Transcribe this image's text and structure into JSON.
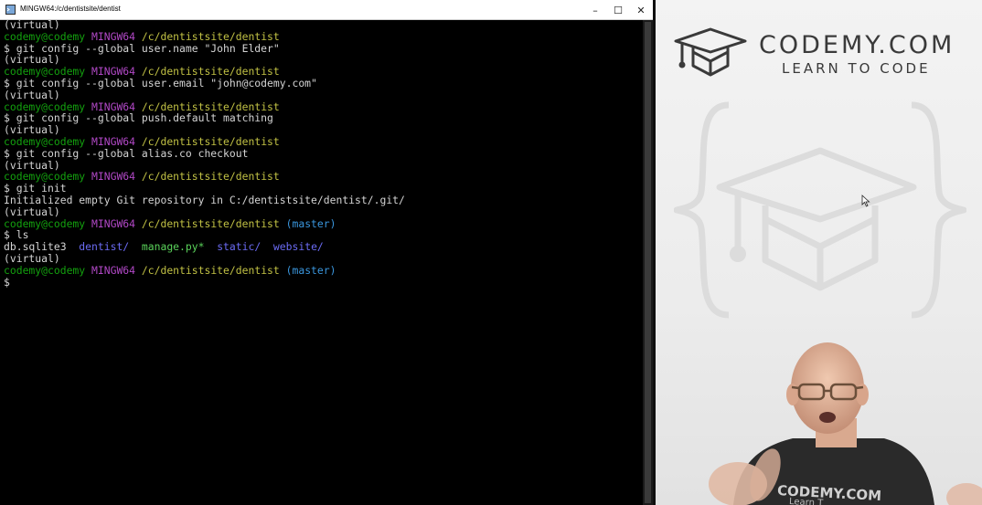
{
  "window": {
    "title": "MINGW64:/c/dentistsite/dentist",
    "minimize_glyph": "–",
    "maximize_glyph": "☐",
    "close_glyph": "✕"
  },
  "colors": {
    "terminal_bg": "#000000",
    "user": "#13a10e",
    "shell": "#b148c6",
    "path": "#c1c144",
    "branch": "#3a96dd",
    "directory": "#6b6bf3",
    "executable": "#5ad25a"
  },
  "terminal": {
    "lines": [
      [
        {
          "t": "(virtual)",
          "c": "white"
        }
      ],
      [
        {
          "t": "codemy@codemy",
          "c": "green"
        },
        {
          "t": " ",
          "c": "white"
        },
        {
          "t": "MINGW64",
          "c": "magenta"
        },
        {
          "t": " ",
          "c": "white"
        },
        {
          "t": "/c/dentistsite/dentist",
          "c": "yellow"
        }
      ],
      [
        {
          "t": "$ git config --global user.name \"John Elder\"",
          "c": "white"
        }
      ],
      [
        {
          "t": "(virtual)",
          "c": "white"
        }
      ],
      [
        {
          "t": "codemy@codemy",
          "c": "green"
        },
        {
          "t": " ",
          "c": "white"
        },
        {
          "t": "MINGW64",
          "c": "magenta"
        },
        {
          "t": " ",
          "c": "white"
        },
        {
          "t": "/c/dentistsite/dentist",
          "c": "yellow"
        }
      ],
      [
        {
          "t": "$ git config --global user.email \"john@codemy.com\"",
          "c": "white"
        }
      ],
      [
        {
          "t": "(virtual)",
          "c": "white"
        }
      ],
      [
        {
          "t": "codemy@codemy",
          "c": "green"
        },
        {
          "t": " ",
          "c": "white"
        },
        {
          "t": "MINGW64",
          "c": "magenta"
        },
        {
          "t": " ",
          "c": "white"
        },
        {
          "t": "/c/dentistsite/dentist",
          "c": "yellow"
        }
      ],
      [
        {
          "t": "$ git config --global push.default matching",
          "c": "white"
        }
      ],
      [
        {
          "t": "(virtual)",
          "c": "white"
        }
      ],
      [
        {
          "t": "codemy@codemy",
          "c": "green"
        },
        {
          "t": " ",
          "c": "white"
        },
        {
          "t": "MINGW64",
          "c": "magenta"
        },
        {
          "t": " ",
          "c": "white"
        },
        {
          "t": "/c/dentistsite/dentist",
          "c": "yellow"
        }
      ],
      [
        {
          "t": "$ git config --global alias.co checkout",
          "c": "white"
        }
      ],
      [
        {
          "t": "(virtual)",
          "c": "white"
        }
      ],
      [
        {
          "t": "codemy@codemy",
          "c": "green"
        },
        {
          "t": " ",
          "c": "white"
        },
        {
          "t": "MINGW64",
          "c": "magenta"
        },
        {
          "t": " ",
          "c": "white"
        },
        {
          "t": "/c/dentistsite/dentist",
          "c": "yellow"
        }
      ],
      [
        {
          "t": "$ git init",
          "c": "white"
        }
      ],
      [
        {
          "t": "Initialized empty Git repository in C:/dentistsite/dentist/.git/",
          "c": "white"
        }
      ],
      [
        {
          "t": "(virtual)",
          "c": "white"
        }
      ],
      [
        {
          "t": "codemy@codemy",
          "c": "green"
        },
        {
          "t": " ",
          "c": "white"
        },
        {
          "t": "MINGW64",
          "c": "magenta"
        },
        {
          "t": " ",
          "c": "white"
        },
        {
          "t": "/c/dentistsite/dentist",
          "c": "yellow"
        },
        {
          "t": " ",
          "c": "white"
        },
        {
          "t": "(master)",
          "c": "cyan"
        }
      ],
      [
        {
          "t": "$ ls",
          "c": "white"
        }
      ],
      [
        {
          "t": "db.sqlite3  ",
          "c": "white"
        },
        {
          "t": "dentist/",
          "c": "blue"
        },
        {
          "t": "  ",
          "c": "white"
        },
        {
          "t": "manage.py*",
          "c": "lime"
        },
        {
          "t": "  ",
          "c": "white"
        },
        {
          "t": "static/",
          "c": "blue"
        },
        {
          "t": "  ",
          "c": "white"
        },
        {
          "t": "website/",
          "c": "blue"
        }
      ],
      [
        {
          "t": "(virtual)",
          "c": "white"
        }
      ],
      [
        {
          "t": "codemy@codemy",
          "c": "green"
        },
        {
          "t": " ",
          "c": "white"
        },
        {
          "t": "MINGW64",
          "c": "magenta"
        },
        {
          "t": " ",
          "c": "white"
        },
        {
          "t": "/c/dentistsite/dentist",
          "c": "yellow"
        },
        {
          "t": " ",
          "c": "white"
        },
        {
          "t": "(master)",
          "c": "cyan"
        }
      ],
      [
        {
          "t": "$",
          "c": "white"
        }
      ]
    ]
  },
  "video_panel": {
    "brand_name": "CODEMY.COM",
    "brand_tagline": "LEARN TO CODE",
    "shirt_text": "CODEMY.COM",
    "shirt_tagline": "Learn T"
  }
}
